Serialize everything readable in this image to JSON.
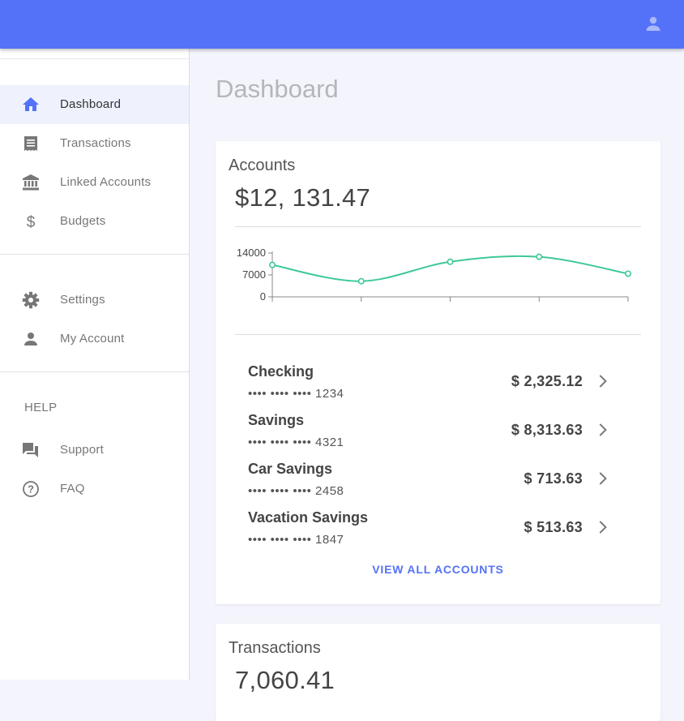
{
  "header": {
    "user_icon": "account-circle-icon",
    "bar_color": "#5472f7"
  },
  "sidebar": {
    "items": [
      {
        "label": "Dashboard",
        "icon": "home-icon",
        "active": true
      },
      {
        "label": "Transactions",
        "icon": "receipt-icon"
      },
      {
        "label": "Linked Accounts",
        "icon": "bank-icon"
      },
      {
        "label": "Budgets",
        "icon": "dollar-icon"
      },
      {
        "label": "Settings",
        "icon": "gear-icon"
      },
      {
        "label": "My Account",
        "icon": "person-icon"
      }
    ],
    "help_header": "HELP",
    "help_items": [
      {
        "label": "Support",
        "icon": "forum-icon"
      },
      {
        "label": "FAQ",
        "icon": "help-circle-icon"
      }
    ]
  },
  "main": {
    "title": "Dashboard",
    "accounts_card": {
      "title": "Accounts",
      "total": "$12, 131.47",
      "accounts": [
        {
          "name": "Checking",
          "number": "•••• •••• •••• 1234",
          "balance": "$ 2,325.12"
        },
        {
          "name": "Savings",
          "number": "•••• •••• •••• 4321",
          "balance": "$ 8,313.63"
        },
        {
          "name": "Car Savings",
          "number": "•••• •••• •••• 2458",
          "balance": "$ 713.63"
        },
        {
          "name": "Vacation Savings",
          "number": "•••• •••• •••• 1847",
          "balance": "$ 513.63"
        }
      ],
      "view_all": "VIEW ALL ACCOUNTS"
    },
    "transactions_card": {
      "title": "Transactions",
      "total": "7,060.41"
    }
  },
  "chart_data": {
    "type": "line",
    "x": [
      0,
      1,
      2,
      3,
      4
    ],
    "values": [
      10200,
      5000,
      11200,
      12800,
      7400
    ],
    "yticks": [
      0,
      7000,
      14000
    ],
    "ylim": [
      0,
      14000
    ],
    "color": "#3ec995"
  }
}
